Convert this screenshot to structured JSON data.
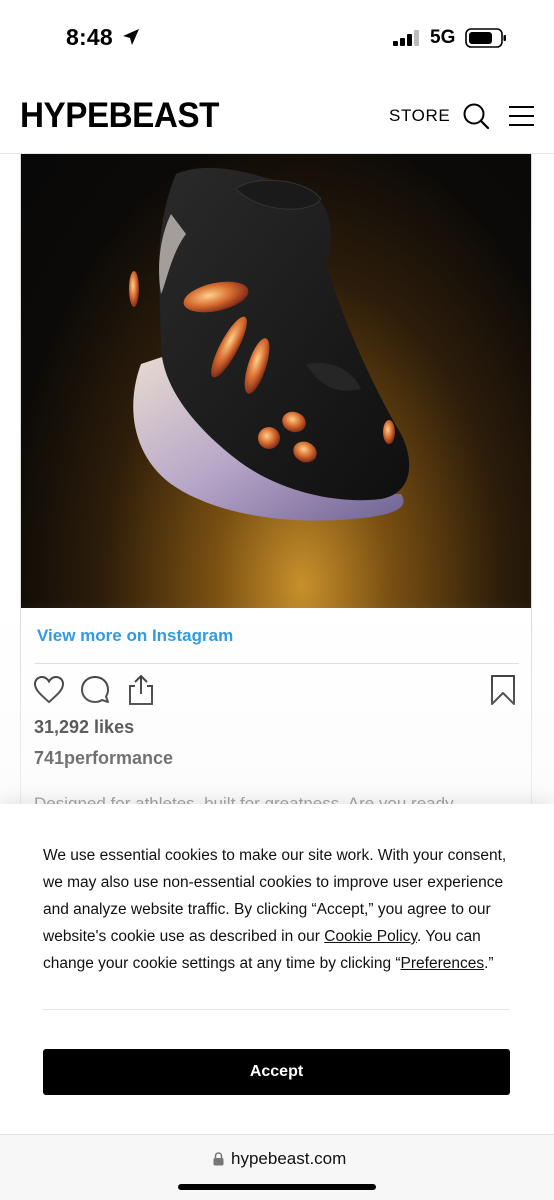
{
  "status_bar": {
    "time": "8:48",
    "network": "5G",
    "icons": [
      "location-arrow-icon",
      "signal-bars-icon",
      "battery-icon"
    ]
  },
  "header": {
    "logo": "HYPEBEAST",
    "store_label": "STORE",
    "icons": [
      "search-icon",
      "hamburger-menu-icon"
    ]
  },
  "instagram_embed": {
    "view_more_label": "View more on Instagram",
    "likes": "31,292 likes",
    "username": "741performance",
    "caption": "Designed for athletes, built for greatness. Are you ready",
    "actions": [
      "heart-icon",
      "comment-icon",
      "share-icon",
      "bookmark-icon"
    ]
  },
  "cookie_banner": {
    "text_1": "We use essential cookies to make our site work. With your consent, we may also use non-essential cookies to improve user experience and analyze website traffic. By clicking “Accept,” you agree to our website's cookie use as described in our ",
    "policy_link": "Cookie Policy",
    "text_2": ". You can change your cookie settings at any time by clicking “",
    "preferences_link": "Preferences",
    "text_3": ".”",
    "accept_label": "Accept"
  },
  "browser": {
    "url": "hypebeast.com"
  },
  "colors": {
    "link_blue": "#1a8fe3",
    "accept_bg": "#000000"
  }
}
